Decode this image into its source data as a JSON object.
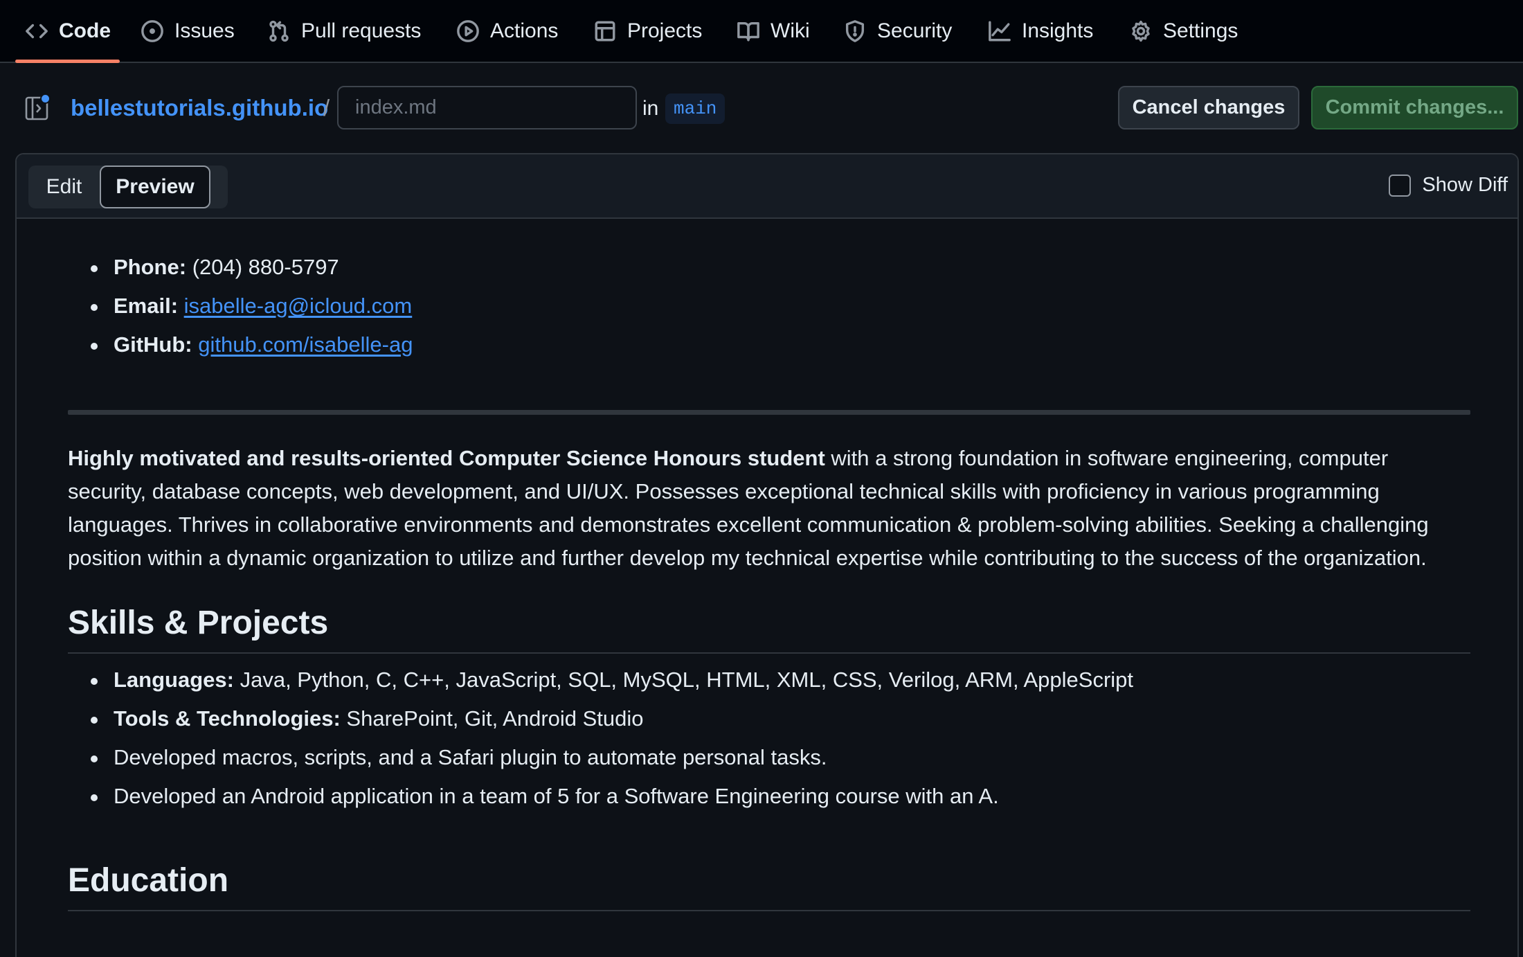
{
  "repo_nav": {
    "items": [
      {
        "label": "Code",
        "icon": "code-icon",
        "selected": true
      },
      {
        "label": "Issues",
        "icon": "issue-opened-icon"
      },
      {
        "label": "Pull requests",
        "icon": "git-pull-request-icon"
      },
      {
        "label": "Actions",
        "icon": "play-icon"
      },
      {
        "label": "Projects",
        "icon": "table-icon"
      },
      {
        "label": "Wiki",
        "icon": "book-icon"
      },
      {
        "label": "Security",
        "icon": "shield-icon"
      },
      {
        "label": "Insights",
        "icon": "graph-icon"
      },
      {
        "label": "Settings",
        "icon": "gear-icon"
      }
    ]
  },
  "file_header": {
    "repo_name": "bellestutorials.github.io",
    "separator": "/",
    "filename_value": "",
    "filename_placeholder": "index.md",
    "in_label": "in",
    "branch": "main",
    "cancel_label": "Cancel changes",
    "commit_label": "Commit changes..."
  },
  "editor": {
    "tabs": [
      {
        "label": "Edit",
        "selected": false
      },
      {
        "label": "Preview",
        "selected": true
      }
    ],
    "show_diff_label": "Show Diff",
    "show_diff_checked": false
  },
  "preview": {
    "contact": [
      {
        "key": "Phone:",
        "value": "(204) 880-5797"
      },
      {
        "key": "Email:",
        "link": "isabelle-ag@icloud.com"
      },
      {
        "key": "GitHub:",
        "link": "github.com/isabelle-ag"
      }
    ],
    "summary_bold": "Highly motivated and results-oriented Computer Science Honours student",
    "summary_rest": " with a strong foundation in software engineering, computer security, database concepts, web development, and UI/UX. Possesses exceptional technical skills with proficiency in various programming languages. Thrives in collaborative environments and demonstrates excellent communication & problem-solving abilities. Seeking a challenging position within a dynamic organization to utilize and further develop my technical expertise while contributing to the success of the organization.",
    "skills_heading": "Skills & Projects",
    "skills": [
      {
        "key": "Languages:",
        "value": " Java, Python, C, C++, JavaScript, SQL, MySQL, HTML, XML, CSS, Verilog, ARM, AppleScript"
      },
      {
        "key": "Tools & Technologies:",
        "value": " SharePoint, Git, Android Studio"
      },
      {
        "key": "",
        "value": "Developed macros, scripts, and a Safari plugin to automate personal tasks."
      },
      {
        "key": "",
        "value": "Developed an Android application in a team of 5 for a Software Engineering course with an A."
      }
    ],
    "education_heading": "Education"
  },
  "colors": {
    "accent_link": "#4493f8",
    "nav_underline": "#f78166",
    "commit_button_bg": "#1f4a2a",
    "page_bg": "#0d1117"
  }
}
